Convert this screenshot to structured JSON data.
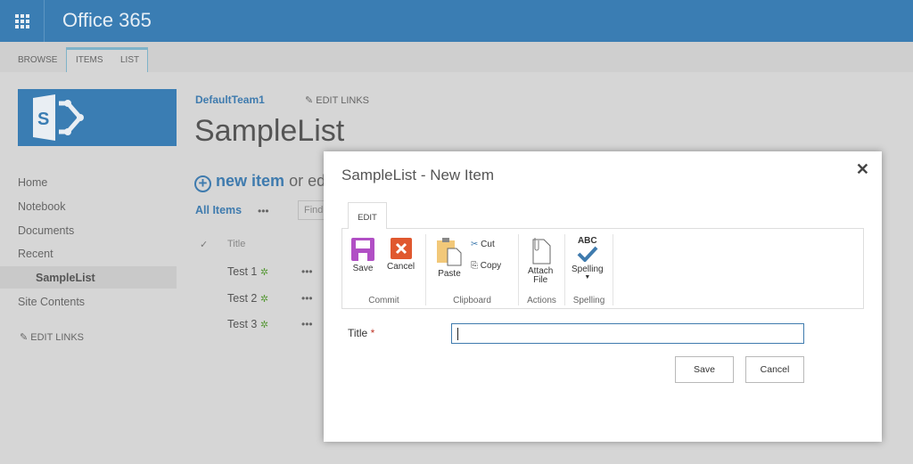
{
  "suite": {
    "title": "Office 365",
    "app_launcher_icon": "waffle-icon"
  },
  "ribbon_tabs": [
    "BROWSE",
    "ITEMS",
    "LIST"
  ],
  "site": {
    "breadcrumb": "DefaultTeam1",
    "edit_links": "EDIT LINKS",
    "page_title": "SampleList"
  },
  "nav": {
    "items": [
      "Home",
      "Notebook",
      "Documents",
      "Recent",
      "SampleList",
      "Site Contents"
    ],
    "edit_links": "EDIT LINKS"
  },
  "list": {
    "new_item": "new item",
    "or_edit": "or ed",
    "view": "All Items",
    "more": "•••",
    "search_placeholder": "Find",
    "column_title": "Title",
    "rows": [
      "Test 1",
      "Test 2",
      "Test 3"
    ],
    "new_marker": "✲"
  },
  "dialog": {
    "title": "SampleList - New Item",
    "close": "✕",
    "tab": "EDIT",
    "groups": {
      "commit": "Commit",
      "clipboard": "Clipboard",
      "actions": "Actions",
      "spelling": "Spelling"
    },
    "buttons": {
      "save": "Save",
      "cancel": "Cancel",
      "paste": "Paste",
      "cut": "Cut",
      "copy": "Copy",
      "attach1": "Attach",
      "attach2": "File",
      "spelling": "Spelling",
      "abc": "ABC"
    },
    "field_label": "Title",
    "required": "*",
    "field_value": "",
    "save_button": "Save",
    "cancel_button": "Cancel"
  }
}
